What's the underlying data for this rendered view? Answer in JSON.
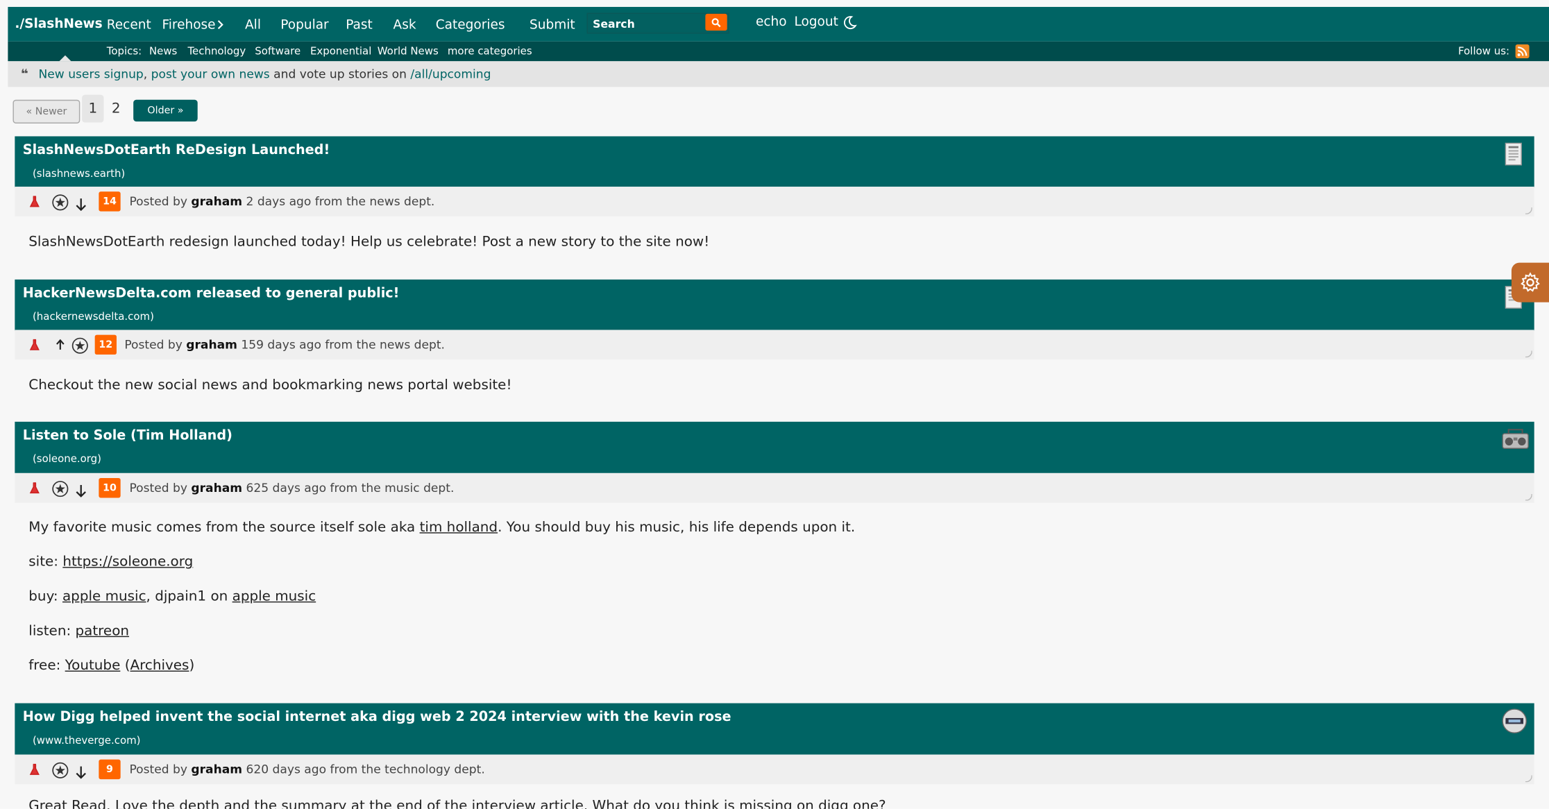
{
  "nav": {
    "logo": "./SlashNews",
    "items": [
      "Recent",
      "Firehose",
      "All",
      "Popular",
      "Past",
      "Ask",
      "Categories",
      "Submit"
    ],
    "search_placeholder": "Search",
    "user": "echo",
    "logout": "Logout"
  },
  "topics": {
    "label": "Topics:",
    "items": [
      "News",
      "Technology",
      "Software",
      "Exponential",
      "World News",
      "more categories"
    ],
    "follow": "Follow us:"
  },
  "banner": {
    "link1": "New users signup",
    "sep": ", ",
    "link2": "post your own news",
    "mid": " and vote up stories on ",
    "link3": "/all/upcoming"
  },
  "pager": {
    "newer": "« Newer",
    "page1": "1",
    "page2": "2",
    "older": "Older »"
  },
  "stories": [
    {
      "title": "SlashNewsDotEarth ReDesign Launched!",
      "domain": "(slashnews.earth)",
      "count": "14",
      "posted_prefix": "Posted by",
      "author": "graham",
      "posted_suffix": "2 days ago from the news dept.",
      "body": "SlashNewsDotEarth redesign launched today! Help us celebrate! Post a new story to the site now!",
      "icon": "news-icon"
    },
    {
      "title": "HackerNewsDelta.com released to general public!",
      "domain": "(hackernewsdelta.com)",
      "count": "12",
      "posted_prefix": "Posted by",
      "author": "graham",
      "posted_suffix": "159 days ago from the news dept.",
      "body": "Checkout the new social news and bookmarking news portal website!",
      "icon": "news-icon"
    },
    {
      "title": "Listen to Sole (Tim Holland)",
      "domain": "(soleone.org)",
      "count": "10",
      "posted_prefix": "Posted by",
      "author": "graham",
      "posted_suffix": "625 days ago from the music dept.",
      "body1_pre": "My favorite music comes from the source itself sole aka ",
      "body1_link": "tim holland",
      "body1_post": ". You should buy his music, his life depends upon it.",
      "site_label": "site: ",
      "site_link": "https://soleone.org",
      "buy_label": "buy: ",
      "buy_link1": "apple music",
      "buy_mid": ", djpain1 on ",
      "buy_link2": "apple music",
      "listen_label": "listen: ",
      "listen_link": "patreon",
      "free_label": "free: ",
      "free_link1": "Youtube",
      "free_open": " (",
      "free_link2": "Archives",
      "free_close": ")",
      "icon": "boombox-icon"
    },
    {
      "title": "How Digg helped invent the social internet aka digg web 2 2024 interview with the kevin rose",
      "domain": "(www.theverge.com)",
      "count": "9",
      "posted_prefix": "Posted by",
      "author": "graham",
      "posted_suffix": "620 days ago from the technology dept.",
      "body": "Great Read. Love the depth and the summary at the end of the interview article. What do you think is missing on digg one?",
      "icon": "technology-icon"
    }
  ],
  "colors": {
    "primary": "#006464",
    "accent": "#ff6600",
    "topics_bar": "#004c4c"
  }
}
